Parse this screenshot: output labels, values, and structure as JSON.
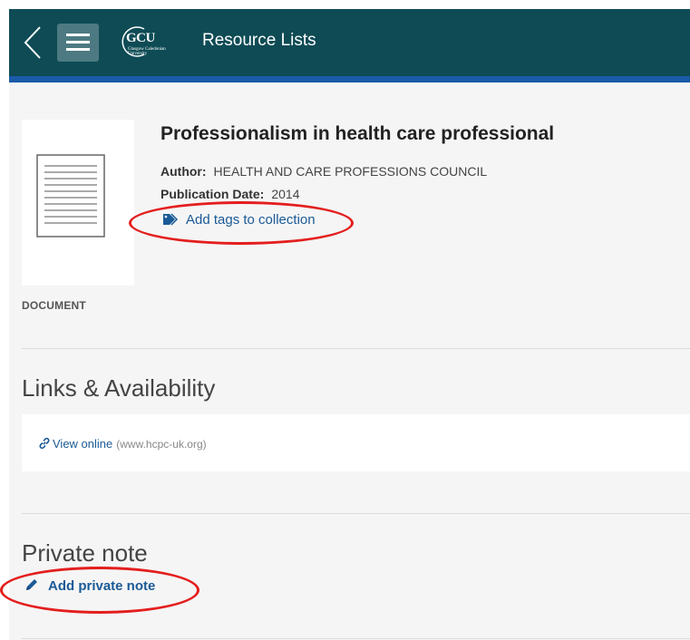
{
  "header": {
    "logo_text": "GCU",
    "logo_subtext": "Glasgow Caledonian University",
    "title": "Resource Lists"
  },
  "resource": {
    "title": "Professionalism in health care professional",
    "author_label": "Author:",
    "author": "HEALTH AND CARE PROFESSIONS COUNCIL",
    "date_label": "Publication Date:",
    "date": "2014",
    "tags_link": "Add tags to collection",
    "type": "DOCUMENT"
  },
  "links_section": {
    "title": "Links & Availability",
    "view_online": "View online",
    "domain": "(www.hcpc-uk.org)"
  },
  "note_section": {
    "title": "Private note",
    "add_note": "Add private note"
  },
  "colors": {
    "header_bg": "#0e4b55",
    "header_stripe": "#1a5ba8",
    "link": "#1a5a96",
    "annotation": "#e41e1e"
  },
  "icons": [
    "back-chevron-icon",
    "hamburger-menu-icon",
    "tag-icon",
    "link-icon",
    "pencil-icon",
    "document-icon"
  ]
}
